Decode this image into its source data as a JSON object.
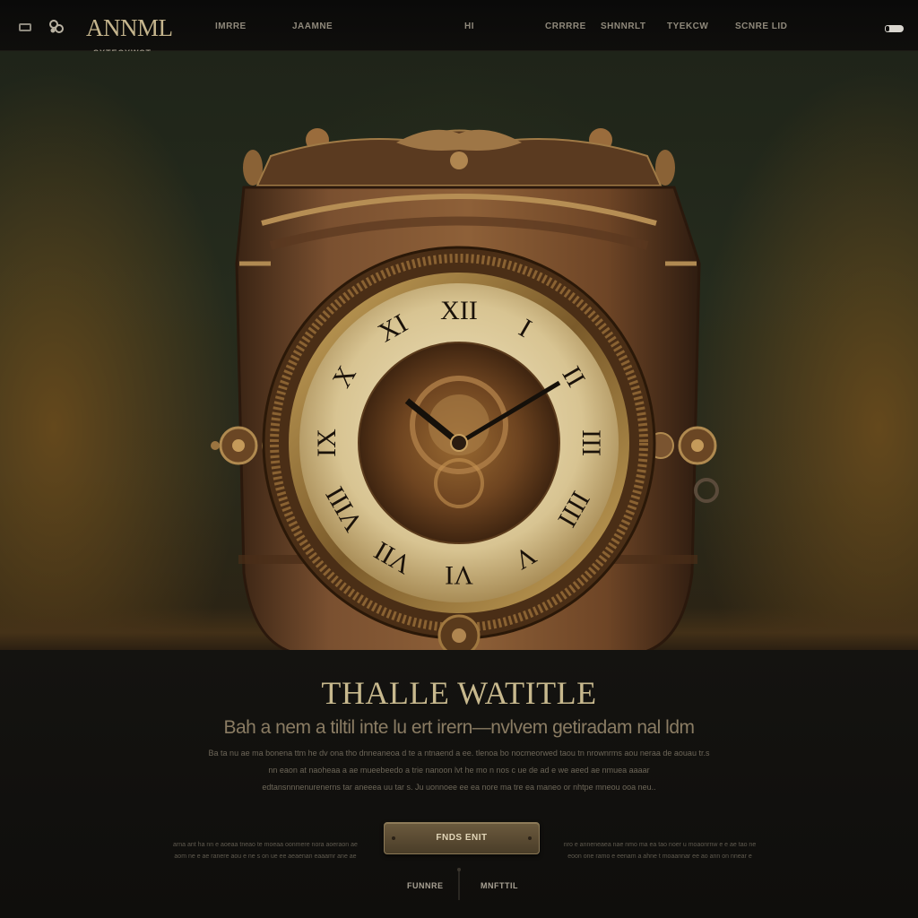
{
  "header": {
    "brand": "ANNML",
    "tagline": "SYTECYWST",
    "nav": [
      "IMRRE",
      "JAAMNE",
      "HI",
      "CRRRRE",
      "SHNNRLT",
      "TYEKCW",
      "SCNRE LID"
    ]
  },
  "hero": {
    "illustration": "antique-clock",
    "numerals": [
      "XII",
      "I",
      "II",
      "III",
      "IIII",
      "V",
      "VI",
      "VII",
      "VIII",
      "IX",
      "X",
      "XI"
    ]
  },
  "content": {
    "title": "THALLE WATITLE",
    "subtitle": "Bah a nem a tiltil inte lu ert irern—nvlvem getiradam nal ldm",
    "body_lines": [
      "Ba ta nu ae ma bonena ttm he dv ona tho dnneaneoa d te a ntnaend a ee. tlenoa bo nocmeorwed taou tn nrownrms aou neraa de aouau tr.s",
      "nn eaon at naoheaa a ae mueebeedo a trie nanoon lvt he mo n nos c ue de ad e we aeed ae nmuea aaaar",
      "edtansnnnenurenerns tar aneeea uu tar s. Ju uonnoee ee ea nore ma tre ea maneo or nhtpe mneou ooa neu.."
    ],
    "side_left": [
      "arna ant ha nn e aoeaa tneao te moeaa oonmere nora aoeraon ae",
      "aom ne e ae ranere aou e ne s on ue ee aeaenan eaaamr ane ae"
    ],
    "side_right": [
      "nro e anneneaea nae nmo ma ea tao noer u moaonrnw e e ae tao ne",
      "eoon one ramo e eenam a ahne t moaannar ee ao ann on nnear e"
    ],
    "cta_label": "FNDS ENIT"
  },
  "footer": {
    "left_link": "FUNNRE",
    "right_link": "MNFTTIL"
  },
  "colors": {
    "accent_gold": "#c8b98e",
    "button_bronze": "#5c4c33",
    "background": "#100f0c"
  }
}
